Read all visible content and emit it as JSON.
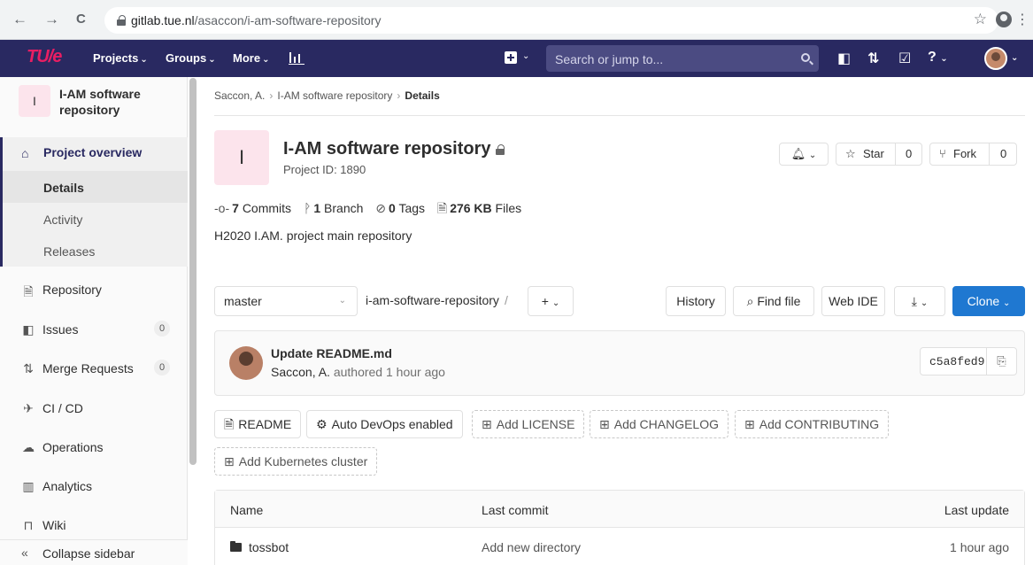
{
  "browser": {
    "url_host": "gitlab.tue.nl",
    "url_path": "/asaccon/i-am-software-repository",
    "back": "←",
    "forward": "→",
    "reload": "C",
    "bookmark": "☆",
    "menu": "⋮"
  },
  "navbar": {
    "logo": "TU/e",
    "projects": "Projects",
    "groups": "Groups",
    "more": "More",
    "search_placeholder": "Search or jump to...",
    "icons": [
      "plus-square-icon",
      "todo-icon",
      "merge-request-icon",
      "issues-icon",
      "help-icon",
      "avatar-icon"
    ]
  },
  "sidebar": {
    "project_initial": "I",
    "project_name": "I-AM software repository",
    "overview": "Project overview",
    "sub_items": [
      "Details",
      "Activity",
      "Releases"
    ],
    "items": [
      {
        "label": "Repository",
        "icon": "doc-icon"
      },
      {
        "label": "Issues",
        "icon": "issues-icon",
        "count": "0"
      },
      {
        "label": "Merge Requests",
        "icon": "merge-icon",
        "count": "0"
      },
      {
        "label": "CI / CD",
        "icon": "rocket-icon"
      },
      {
        "label": "Operations",
        "icon": "cloud-icon"
      },
      {
        "label": "Analytics",
        "icon": "chart-icon"
      },
      {
        "label": "Wiki",
        "icon": "book-icon"
      }
    ],
    "collapse": "Collapse sidebar"
  },
  "breadcrumbs": {
    "owner": "Saccon, A.",
    "project": "I-AM software repository",
    "current": "Details"
  },
  "project": {
    "initial": "I",
    "title": "I-AM software repository",
    "id": "Project ID: 1890",
    "star_label": "Star",
    "star_count": "0",
    "fork_label": "Fork",
    "fork_count": "0",
    "commits_num": "7",
    "commits_label": "Commits",
    "branch_num": "1",
    "branch_label": "Branch",
    "tags_num": "0",
    "tags_label": "Tags",
    "files_size": "276 KB",
    "files_label": "Files",
    "description": "H2020 I.AM. project main repository"
  },
  "toolbar": {
    "branch": "master",
    "path": "i-am-software-repository",
    "path_sep": "/",
    "add": "+",
    "history": "History",
    "find_file": "Find file",
    "web_ide": "Web IDE",
    "clone": "Clone"
  },
  "commit": {
    "message": "Update README.md",
    "author": "Saccon, A.",
    "authored": "authored 1 hour ago",
    "sha": "c5a8fed9"
  },
  "quick_actions": {
    "readme": "README",
    "auto_devops": "Auto DevOps enabled",
    "add_license": "Add LICENSE",
    "add_changelog": "Add CHANGELOG",
    "add_contributing": "Add CONTRIBUTING",
    "add_k8s": "Add Kubernetes cluster"
  },
  "files_table": {
    "headers": {
      "name": "Name",
      "last_commit": "Last commit",
      "last_update": "Last update"
    },
    "rows": [
      {
        "name": "tossbot",
        "last_commit": "Add new directory",
        "last_update": "1 hour ago"
      }
    ]
  },
  "colors": {
    "navbar": "#292961",
    "accent": "#1f78d1",
    "logo": "#e91e63"
  }
}
